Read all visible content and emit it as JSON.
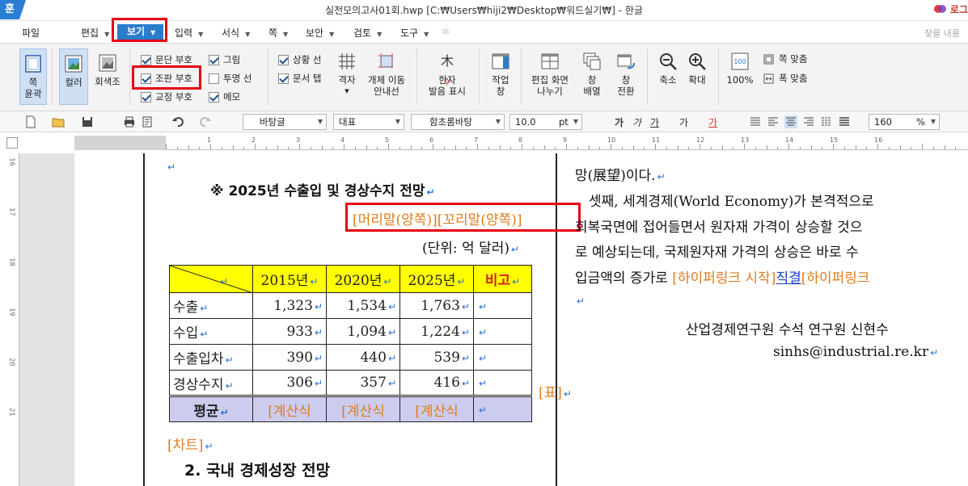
{
  "title_bar": {
    "logo": "훈",
    "window_title": "실전모의고사01회.hwp [C:₩Users₩hiji2₩Desktop₩워드실기₩] - 한글",
    "login_label": "로그"
  },
  "menu": {
    "file": "파일",
    "edit": "편집",
    "view": "보기",
    "input": "입력",
    "format": "서식",
    "page": "쪽",
    "security": "보안",
    "review": "검토",
    "tools": "도구",
    "find_placeholder": "찾을 내용"
  },
  "ribbon": {
    "page_outline": "쪽\n윤곽",
    "color": "컬러",
    "grayscale": "회색조",
    "checkboxes": {
      "para_marks": {
        "label": "문단 부호",
        "checked": true
      },
      "edit_marks": {
        "label": "조판 부호",
        "checked": true
      },
      "proof_marks": {
        "label": "교정 부호",
        "checked": true
      },
      "picture": {
        "label": "그림",
        "checked": true
      },
      "transparent_line": {
        "label": "투명 선",
        "checked": false
      },
      "memo": {
        "label": "메모",
        "checked": true
      },
      "status_line": {
        "label": "상황 선",
        "checked": true
      },
      "doc_tab": {
        "label": "문서 탭",
        "checked": true
      }
    },
    "grid": "격자",
    "object_move_guide": "개체 이동\n안내선",
    "hanja_pron": "한자\n발음 표시",
    "work_window": "작업\n창",
    "split_screen": "편집 화면\n나누기",
    "window_arrange": "창\n배열",
    "window_switch": "창\n전환",
    "zoom_out": "축소",
    "zoom_in": "확대",
    "zoom_100": "100%",
    "fit_page": "쪽 맞춤",
    "fit_width": "폭 맞춤"
  },
  "toolbar": {
    "style": "바탕글",
    "lang": "대표",
    "font": "함초롬바탕",
    "size": "10.0",
    "size_unit": "pt",
    "bold": "가",
    "italic": "가",
    "underline": "가",
    "strike": "가",
    "color_text": "가",
    "zoom": "160",
    "zoom_unit": "%"
  },
  "ruler": {
    "h_numbers": [
      "1",
      "2",
      "3",
      "4",
      "5",
      "6",
      "7",
      "8",
      "9",
      "10",
      "11",
      "12",
      "13",
      "14",
      "15",
      "16"
    ],
    "v_numbers": [
      "16",
      "17",
      "18",
      "19",
      "20",
      "21"
    ]
  },
  "doc": {
    "return_mark": "↵",
    "heading": "※ 2025년 수출입 및 경상수지 전망",
    "header_footer_field": "[머리말(양쪽)][꼬리말(양쪽)]",
    "unit": "(단위: 억 달러)",
    "table": {
      "headers": [
        "2015년",
        "2020년",
        "2025년",
        "비고"
      ],
      "rows": [
        {
          "label": "수출",
          "values": [
            "1,323",
            "1,534",
            "1,763"
          ]
        },
        {
          "label": "수입",
          "values": [
            "933",
            "1,094",
            "1,224"
          ]
        },
        {
          "label": "수출입차",
          "values": [
            "390",
            "440",
            "539"
          ]
        },
        {
          "label": "경상수지",
          "values": [
            "306",
            "357",
            "416"
          ]
        }
      ],
      "avg_label": "평균",
      "calc": "[계산식"
    },
    "table_field": "[표]",
    "chart_field": "[차트]",
    "section2": "2. 국내 경제성장 전망",
    "right_col": {
      "line1": "망(展望)이다.",
      "line2": "셋째, 세계경제(World Economy)가 본격적으로",
      "line3": "회복국면에 접어들면서 원자재 가격이 상승할 것으",
      "line4": "로 예상되는데, 국제원자재 가격의 상승은 바로 수",
      "line5_a": "입금액의 증가로 ",
      "line5_b": "[하이퍼링크 시작]",
      "line5_c": "직결",
      "line5_d": "[하이퍼링크 ",
      "author": "산업경제연구원 수석 연구원 신현수",
      "email": "sinhs@industrial.re.kr"
    }
  }
}
